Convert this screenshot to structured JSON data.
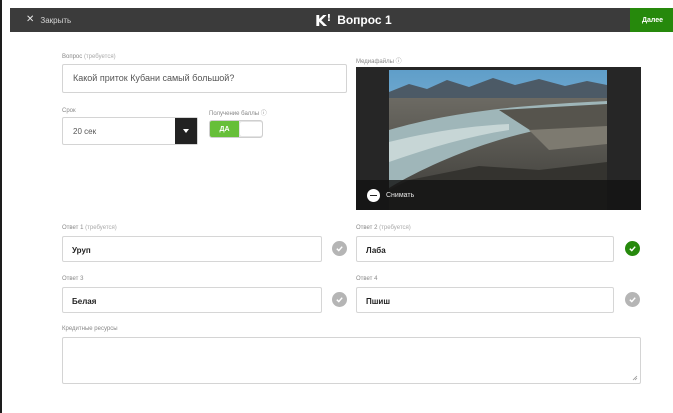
{
  "topbar": {
    "close_label": "Закрыть",
    "logo": "K",
    "logo_mark": "!",
    "title": "Вопрос 1",
    "done_label": "Далее"
  },
  "question": {
    "label": "Вопрос",
    "required": "(требуется)",
    "value": "Какой приток Кубани самый большой?"
  },
  "time": {
    "label": "Срок",
    "value": "20 сек"
  },
  "points": {
    "label": "Получение баллы ⓘ",
    "toggle_value": "ДА"
  },
  "media": {
    "label": "Медиафайлы ⓘ",
    "remove_label": "Снимать"
  },
  "answers": [
    {
      "label": "Ответ 1",
      "required": "(требуется)",
      "value": "Уруп",
      "correct": false
    },
    {
      "label": "Ответ 2",
      "required": "(требуется)",
      "value": "Лаба",
      "correct": true
    },
    {
      "label": "Ответ 3",
      "required": "",
      "value": "Белая",
      "correct": false
    },
    {
      "label": "Ответ 4",
      "required": "",
      "value": "Пшиш",
      "correct": false
    }
  ],
  "credits": {
    "label": "Кредитные ресурсы",
    "value": ""
  },
  "colors": {
    "topbar": "#3b3b3b",
    "done": "#26890c",
    "toggle_on": "#66bf39",
    "correct": "#26890c",
    "neutral_check": "#b5b5b5"
  }
}
